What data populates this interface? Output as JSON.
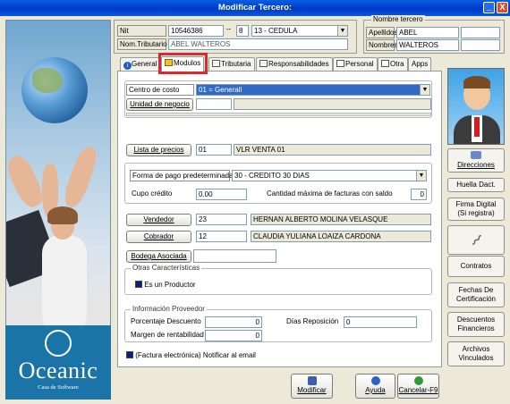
{
  "window": {
    "title": "Modificar Tercero:",
    "min_label": "_",
    "close_label": "X"
  },
  "header": {
    "nit_label": "Nit",
    "nit_value": "10546386",
    "dash": "--",
    "dv_value": "8",
    "doc_type": "13 - CEDULA",
    "nom_tributario_label": "Nom.Tributario",
    "nom_tributario_value": "ABEL  WALTEROS"
  },
  "name_group": {
    "caption": "Nombre tercero",
    "apellidos_label": "Apellidos",
    "apellidos_value": "ABEL",
    "nombres_label": "Nombres",
    "nombres_value": "WALTEROS"
  },
  "tabs": [
    {
      "label": "General",
      "icon": "info-icon"
    },
    {
      "label": "Modulos",
      "icon": "modules-icon"
    },
    {
      "label": "Tributaria",
      "icon": "table-icon"
    },
    {
      "label": "Responsabilidades",
      "icon": "table-icon"
    },
    {
      "label": "Personal",
      "icon": "doc-icon"
    },
    {
      "label": "Otra",
      "icon": "doc-icon"
    },
    {
      "label": "Apps",
      "icon": ""
    }
  ],
  "form": {
    "centro_costo_label": "Centro de costo",
    "centro_costo_value": "01 = Generall",
    "unidad_negocio_label": "Unidad de negocio",
    "lista_precios_label": "Lista de precios",
    "lista_precios_code": "01",
    "lista_precios_name": "VLR VENTA 01",
    "forma_pago_label": "Forma de pago predeterminada",
    "forma_pago_value": "30 - CREDITO 30 DIAS",
    "cupo_credito_label": "Cupo crédito",
    "cupo_credito_value": "0.00",
    "cant_max_label": "Cantidad máxima de facturas con saldo",
    "cant_max_value": "0",
    "vendedor_label": "Vendedor",
    "vendedor_code": "23",
    "vendedor_name": "HERNAN ALBERTO MOLINA VELASQUE",
    "cobrador_label": "Cobrador",
    "cobrador_code": "12",
    "cobrador_name": "CLAUDIA YULIANA LOAIZA CARDONA",
    "bodega_label": "Bodega Asociada",
    "otras_caption": "Otras Características",
    "es_productor_label": "Es un Productor",
    "info_prov_caption": "Información Proveedor",
    "porcentaje_label": "Porcentaje Descuento",
    "porcentaje_value": "0",
    "dias_label": "Días Reposición",
    "dias_value": "0",
    "margen_label": "Margen de rentabilidad",
    "margen_value": "0",
    "factura_label": "(Factura electrónica) Notificar al email"
  },
  "side": {
    "direcciones": "Direcciones",
    "huella": "Huella Dact.",
    "firma": "Firma Digital",
    "firma_sub": "(Si registra)",
    "contratos": "Contratos",
    "fechas": "Fechas De Certificación",
    "descuentos": "Descuentos Financieros",
    "archivos": "Archivos Vinculados"
  },
  "bottom": {
    "modificar": "Modificar",
    "ayuda": "Ayuda",
    "cancelar": "Cancelar-F9"
  },
  "logo": {
    "word": "Oceanic",
    "sub": "Casa de Software"
  },
  "colors": {
    "title_bar": "#0A5FE0",
    "highlight": "#316AC5",
    "annotation_red": "#E0262E"
  }
}
